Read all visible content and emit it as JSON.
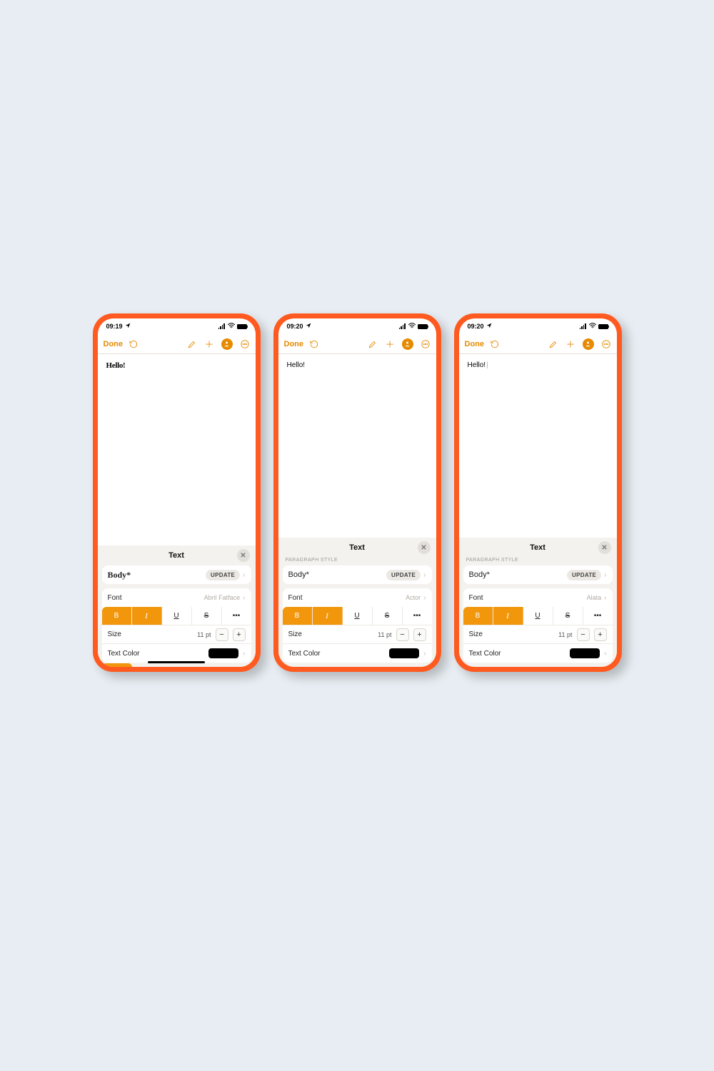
{
  "colors": {
    "accent": "#e68a00",
    "highlight": "#f2960c"
  },
  "phones": [
    {
      "time": "09:19",
      "done": "Done",
      "content": "Hello!",
      "contentStyle": "serif-bold",
      "panelTitle": "Text",
      "showSectionLabel": false,
      "bodyLabel": "Body*",
      "bodyStyle": "serif",
      "update": "UPDATE",
      "fontLabel": "Font",
      "fontName": "Abril Fatface",
      "sizeLabel": "Size",
      "sizeValue": "11 pt",
      "textColorLabel": "Text Color",
      "showHomeIndicator": true,
      "showOrangeTab": true
    },
    {
      "time": "09:20",
      "done": "Done",
      "content": "Hello!",
      "contentStyle": "plain",
      "panelTitle": "Text",
      "showSectionLabel": true,
      "sectionLabel": "PARAGRAPH STYLE",
      "bodyLabel": "Body*",
      "bodyStyle": "plain",
      "update": "UPDATE",
      "fontLabel": "Font",
      "fontName": "Actor",
      "sizeLabel": "Size",
      "sizeValue": "11 pt",
      "textColorLabel": "Text Color",
      "showHomeIndicator": false,
      "showOrangeTab": false
    },
    {
      "time": "09:20",
      "done": "Done",
      "content": "Hello!",
      "contentStyle": "plain",
      "cursor": true,
      "panelTitle": "Text",
      "showSectionLabel": true,
      "sectionLabel": "PARAGRAPH STYLE",
      "bodyLabel": "Body*",
      "bodyStyle": "plain",
      "update": "UPDATE",
      "fontLabel": "Font",
      "fontName": "Alata",
      "sizeLabel": "Size",
      "sizeValue": "11 pt",
      "textColorLabel": "Text Color",
      "showHomeIndicator": false,
      "showOrangeTab": false
    }
  ],
  "fmtButtons": {
    "bold": "B",
    "italic": "I",
    "underline": "U",
    "strike": "S",
    "more": "•••"
  },
  "stepper": {
    "minus": "−",
    "plus": "+"
  }
}
